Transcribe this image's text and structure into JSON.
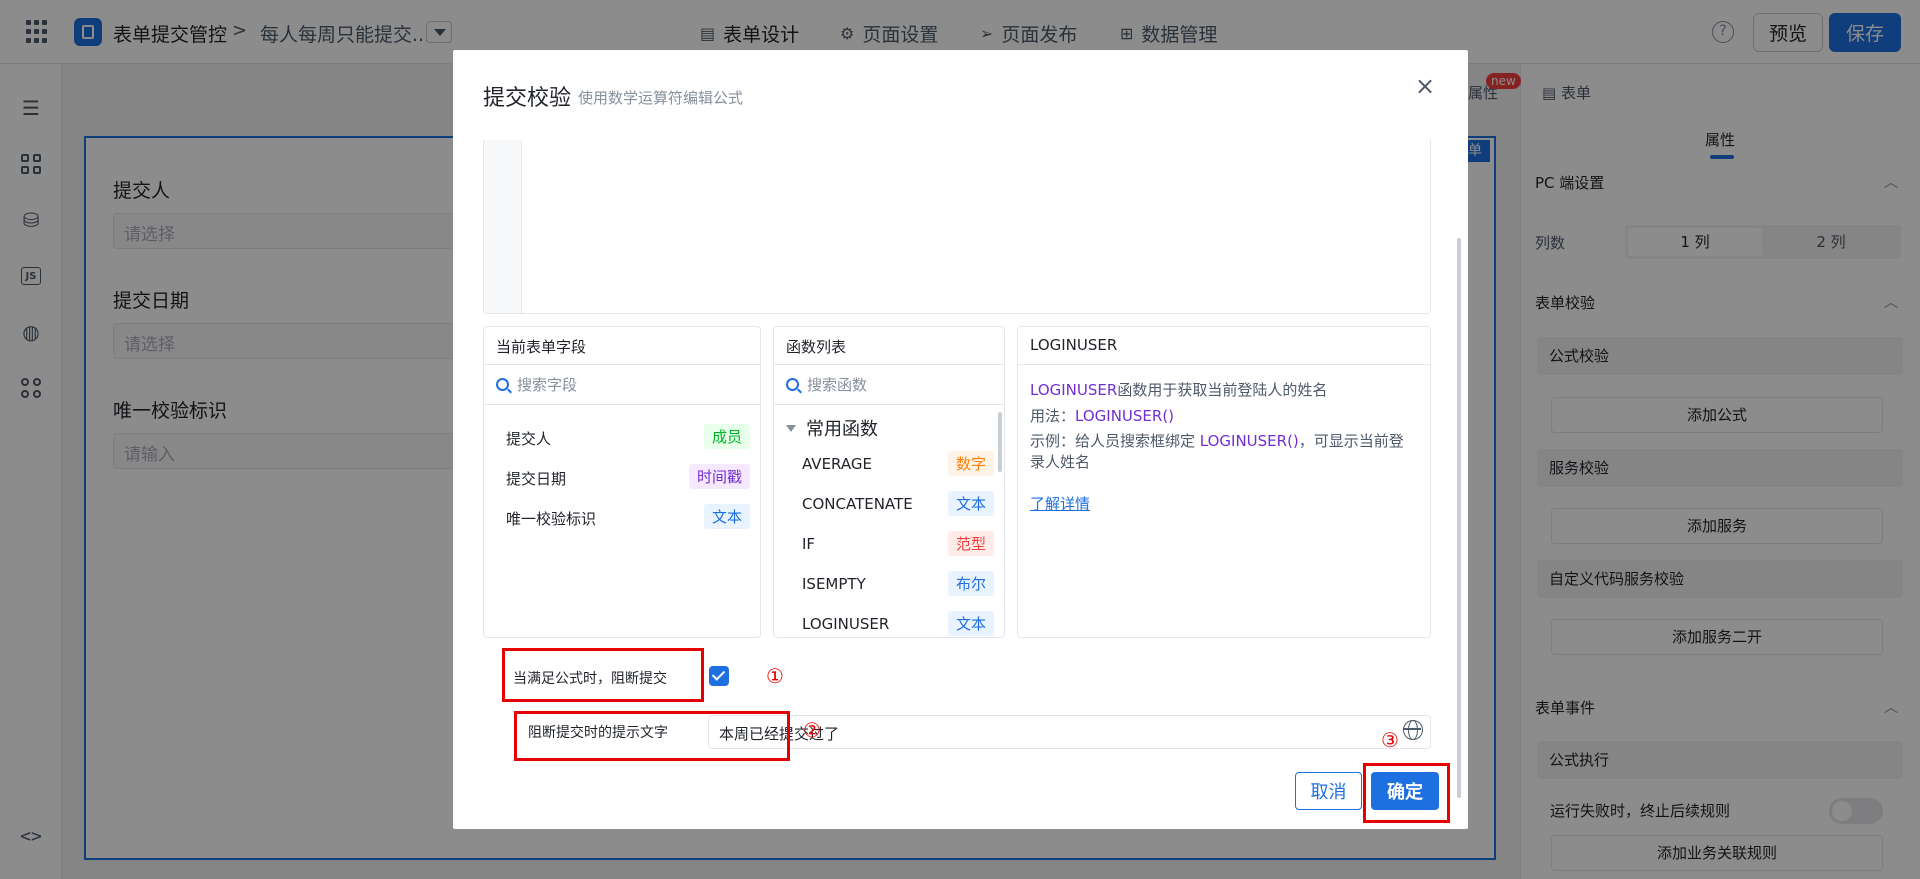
{
  "topbar": {
    "app_name": "表单提交管控",
    "breadcrumb_sep": ">",
    "form_name": "每人每周只能提交...",
    "tabs": [
      {
        "label": "表单设计",
        "icon": "document-icon"
      },
      {
        "label": "页面设置",
        "icon": "gear-icon"
      },
      {
        "label": "页面发布",
        "icon": "send-icon"
      },
      {
        "label": "数据管理",
        "icon": "table-icon"
      }
    ],
    "help": "?",
    "preview_label": "预览",
    "save_label": "保存"
  },
  "sidebar_icons": [
    "outline-icon",
    "components-icon",
    "datasource-icon",
    "js-icon",
    "globe-icon",
    "apps-icon",
    "code-icon"
  ],
  "sidebar_js": "JS",
  "sidebar_code": "<>",
  "canvas": {
    "tag": "单",
    "fields": [
      {
        "label": "提交人",
        "placeholder": "请选择"
      },
      {
        "label": "提交日期",
        "placeholder": "请选择"
      },
      {
        "label": "唯一校验标识",
        "placeholder": "请输入"
      }
    ]
  },
  "right_panel": {
    "tab_attr_partial": "属性",
    "new_badge": "new",
    "tab_form": "表单",
    "active_tab": "属性",
    "pc_section": "PC 端设置",
    "cols_label": "列数",
    "cols_options": [
      "1 列",
      "2 列"
    ],
    "validation_section": "表单校验",
    "formula_validation": "公式校验",
    "add_formula": "添加公式",
    "service_validation": "服务校验",
    "add_service": "添加服务",
    "custom_code_validation": "自定义代码服务校验",
    "add_service_dev": "添加服务二开",
    "events_section": "表单事件",
    "formula_exec": "公式执行",
    "stop_on_fail": "运行失败时，终止后续规则",
    "add_biz_rule": "添加业务关联规则"
  },
  "modal": {
    "title": "提交校验",
    "subtitle": "使用数学运算符编辑公式",
    "close": "×",
    "fields_panel": {
      "title": "当前表单字段",
      "search_placeholder": "搜索字段",
      "items": [
        {
          "name": "提交人",
          "type": "成员",
          "color": "green"
        },
        {
          "name": "提交日期",
          "type": "时间戳",
          "color": "purple"
        },
        {
          "name": "唯一校验标识",
          "type": "文本",
          "color": "blue"
        }
      ]
    },
    "functions_panel": {
      "title": "函数列表",
      "search_placeholder": "搜索函数",
      "group": "常用函数",
      "items": [
        {
          "name": "AVERAGE",
          "type": "数字",
          "color": "orange"
        },
        {
          "name": "CONCATENATE",
          "type": "文本",
          "color": "blue"
        },
        {
          "name": "IF",
          "type": "范型",
          "color": "red"
        },
        {
          "name": "ISEMPTY",
          "type": "布尔",
          "color": "blue"
        },
        {
          "name": "LOGINUSER",
          "type": "文本",
          "color": "blue"
        }
      ]
    },
    "doc_panel": {
      "title": "LOGINUSER",
      "desc_fn": "LOGINUSER",
      "desc_text": "函数用于获取当前登陆人的姓名",
      "usage_label": "用法：",
      "usage_fn": "LOGINUSER()",
      "example_label": "示例：给人员搜索框绑定 ",
      "example_fn": "LOGINUSER()",
      "example_text": "，可显示当前登录人姓名",
      "learn_more": "了解详情"
    },
    "block_option_label": "当满足公式时，阻断提交",
    "block_option_checked": true,
    "tip_label": "阻断提交时的提示文字",
    "tip_value": "本周已经提交过了",
    "cancel_label": "取消",
    "ok_label": "确定"
  },
  "annotations": [
    "①",
    "②",
    "③"
  ]
}
